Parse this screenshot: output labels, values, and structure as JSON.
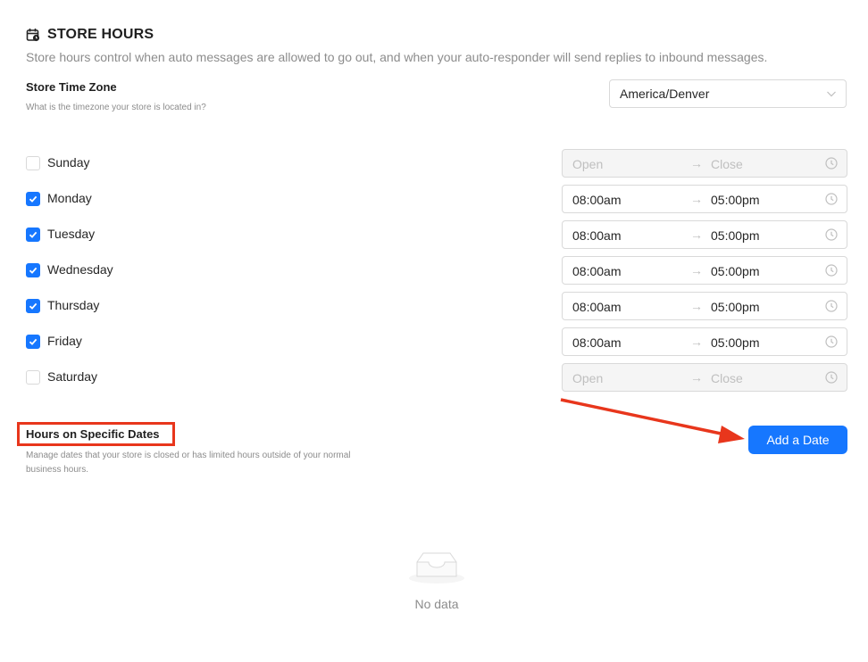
{
  "header": {
    "title": "STORE HOURS",
    "description": "Store hours control when auto messages are allowed to go out, and when your auto-responder will send replies to inbound messages."
  },
  "timezone": {
    "title": "Store Time Zone",
    "subtitle": "What is the timezone your store is located in?",
    "value": "America/Denver"
  },
  "days": [
    {
      "label": "Sunday",
      "checked": false,
      "open": "Open",
      "close": "Close"
    },
    {
      "label": "Monday",
      "checked": true,
      "open": "08:00am",
      "close": "05:00pm"
    },
    {
      "label": "Tuesday",
      "checked": true,
      "open": "08:00am",
      "close": "05:00pm"
    },
    {
      "label": "Wednesday",
      "checked": true,
      "open": "08:00am",
      "close": "05:00pm"
    },
    {
      "label": "Thursday",
      "checked": true,
      "open": "08:00am",
      "close": "05:00pm"
    },
    {
      "label": "Friday",
      "checked": true,
      "open": "08:00am",
      "close": "05:00pm"
    },
    {
      "label": "Saturday",
      "checked": false,
      "open": "Open",
      "close": "Close"
    }
  ],
  "specific_dates": {
    "title": "Hours on Specific Dates",
    "subtitle": "Manage dates that your store is closed or has limited hours outside of your normal business hours.",
    "add_button": "Add a Date",
    "empty_text": "No data"
  },
  "colors": {
    "accent": "#1677ff",
    "annotation": "#e8361c"
  }
}
